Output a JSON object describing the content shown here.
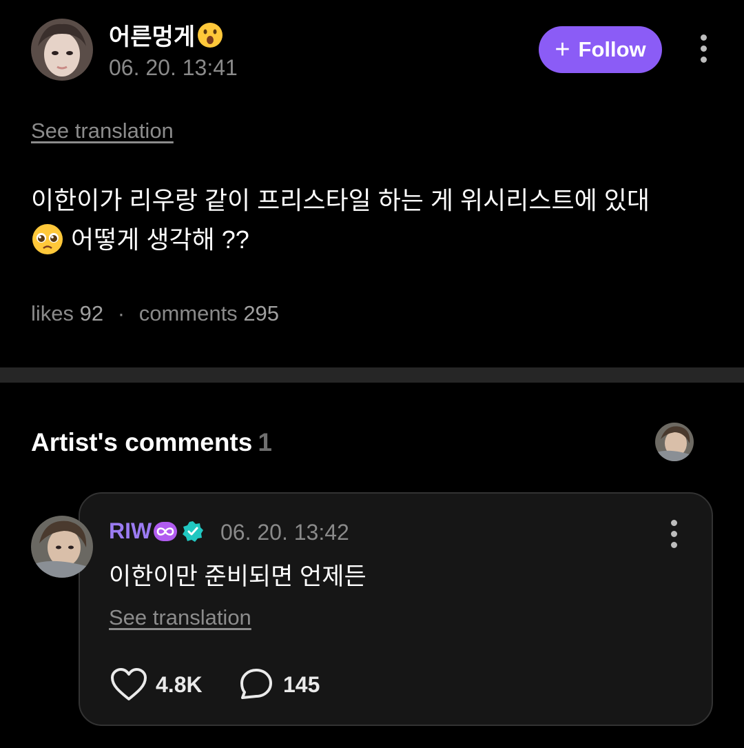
{
  "post": {
    "author_name": "어른멍게",
    "author_emoji": "astonished-face",
    "timestamp": "06. 20. 13:41",
    "follow_label": "Follow",
    "see_translation": "See translation",
    "body_line1": "이한이가 리우랑 같이 프리스타일 하는 게 위시리스트에 있대",
    "body_line2": "어떻게 생각해 ??",
    "body_emoji": "pleading-face",
    "likes_label": "likes",
    "likes_count": "92",
    "separator": "·",
    "comments_label": "comments",
    "comments_count": "295"
  },
  "artist_comments": {
    "title": "Artist's comments",
    "count": "1"
  },
  "comment": {
    "author_name": "RIW",
    "badges": [
      "infinity-badge",
      "verified-badge"
    ],
    "timestamp": "06. 20. 13:42",
    "body": "이한이만 준비되면 언제든",
    "see_translation": "See translation",
    "like_count": "4.8K",
    "reply_count": "145"
  },
  "colors": {
    "background": "#000000",
    "accent": "#8b5cf6",
    "artist_name": "#9b7bf2",
    "verified": "#21c7c1",
    "muted_text": "#8a8a8a",
    "card_background": "#161616"
  },
  "icons": [
    "plus-icon",
    "more-vertical-icon",
    "heart-icon",
    "comment-bubble-icon"
  ]
}
